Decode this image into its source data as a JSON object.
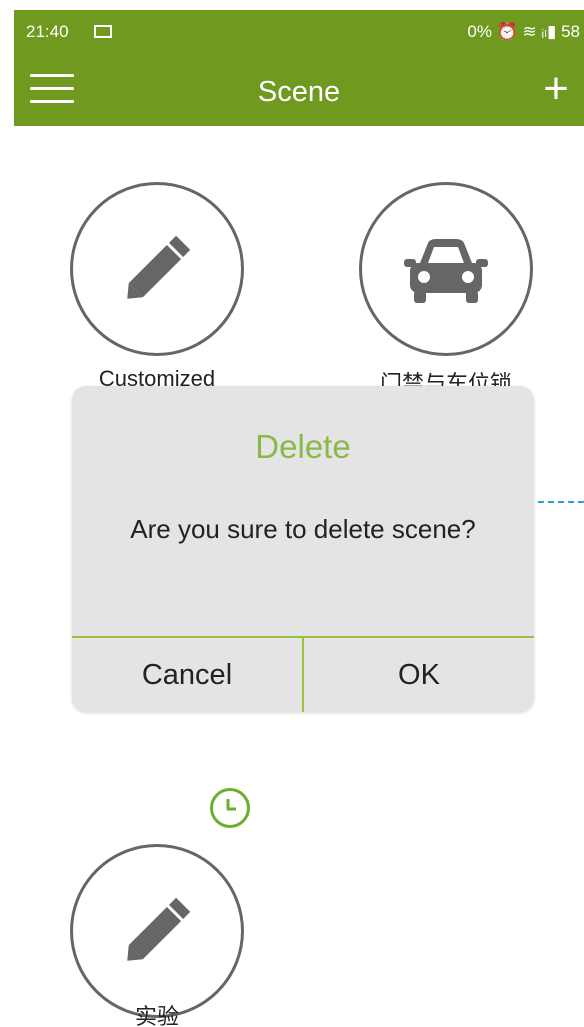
{
  "status_bar": {
    "time": "21:40",
    "right": "0% ⏰ ≋ ᵢₗ▮ 58"
  },
  "app_bar": {
    "title": "Scene",
    "menu_icon": "hamburger-menu",
    "add_icon": "plus"
  },
  "scenes": [
    {
      "label": "Customized",
      "icon": "pencil"
    },
    {
      "label": "门禁与车位锁",
      "icon": "car"
    },
    {
      "label": "实验",
      "icon": "pencil",
      "has_timer": true
    }
  ],
  "dialog": {
    "title": "Delete",
    "message": "Are you sure to delete scene?",
    "cancel_label": "Cancel",
    "ok_label": "OK"
  },
  "colors": {
    "primary": "#6f9a1f",
    "dialog_title": "#8ab84a",
    "divider": "#9cc23a",
    "dialog_bg": "#e4e4e4"
  }
}
